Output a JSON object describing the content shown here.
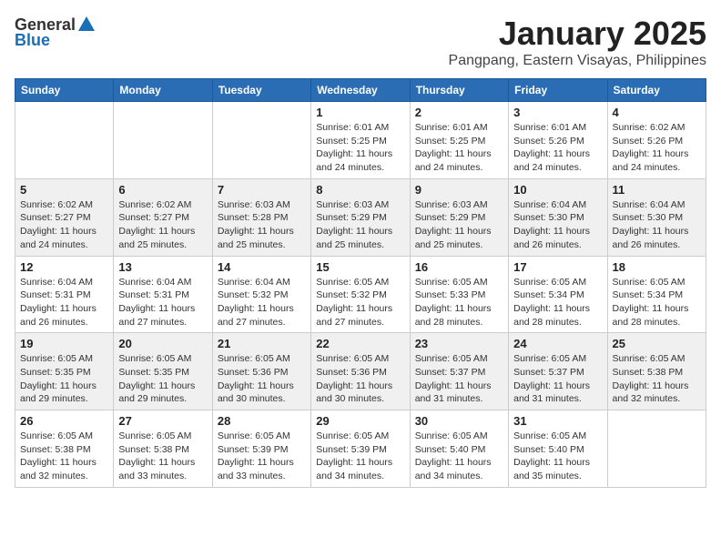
{
  "header": {
    "logo_general": "General",
    "logo_blue": "Blue",
    "month_title": "January 2025",
    "location": "Pangpang, Eastern Visayas, Philippines"
  },
  "weekdays": [
    "Sunday",
    "Monday",
    "Tuesday",
    "Wednesday",
    "Thursday",
    "Friday",
    "Saturday"
  ],
  "weeks": [
    [
      {
        "day": "",
        "sunrise": "",
        "sunset": "",
        "daylight": ""
      },
      {
        "day": "",
        "sunrise": "",
        "sunset": "",
        "daylight": ""
      },
      {
        "day": "",
        "sunrise": "",
        "sunset": "",
        "daylight": ""
      },
      {
        "day": "1",
        "sunrise": "Sunrise: 6:01 AM",
        "sunset": "Sunset: 5:25 PM",
        "daylight": "Daylight: 11 hours and 24 minutes."
      },
      {
        "day": "2",
        "sunrise": "Sunrise: 6:01 AM",
        "sunset": "Sunset: 5:25 PM",
        "daylight": "Daylight: 11 hours and 24 minutes."
      },
      {
        "day": "3",
        "sunrise": "Sunrise: 6:01 AM",
        "sunset": "Sunset: 5:26 PM",
        "daylight": "Daylight: 11 hours and 24 minutes."
      },
      {
        "day": "4",
        "sunrise": "Sunrise: 6:02 AM",
        "sunset": "Sunset: 5:26 PM",
        "daylight": "Daylight: 11 hours and 24 minutes."
      }
    ],
    [
      {
        "day": "5",
        "sunrise": "Sunrise: 6:02 AM",
        "sunset": "Sunset: 5:27 PM",
        "daylight": "Daylight: 11 hours and 24 minutes."
      },
      {
        "day": "6",
        "sunrise": "Sunrise: 6:02 AM",
        "sunset": "Sunset: 5:27 PM",
        "daylight": "Daylight: 11 hours and 25 minutes."
      },
      {
        "day": "7",
        "sunrise": "Sunrise: 6:03 AM",
        "sunset": "Sunset: 5:28 PM",
        "daylight": "Daylight: 11 hours and 25 minutes."
      },
      {
        "day": "8",
        "sunrise": "Sunrise: 6:03 AM",
        "sunset": "Sunset: 5:29 PM",
        "daylight": "Daylight: 11 hours and 25 minutes."
      },
      {
        "day": "9",
        "sunrise": "Sunrise: 6:03 AM",
        "sunset": "Sunset: 5:29 PM",
        "daylight": "Daylight: 11 hours and 25 minutes."
      },
      {
        "day": "10",
        "sunrise": "Sunrise: 6:04 AM",
        "sunset": "Sunset: 5:30 PM",
        "daylight": "Daylight: 11 hours and 26 minutes."
      },
      {
        "day": "11",
        "sunrise": "Sunrise: 6:04 AM",
        "sunset": "Sunset: 5:30 PM",
        "daylight": "Daylight: 11 hours and 26 minutes."
      }
    ],
    [
      {
        "day": "12",
        "sunrise": "Sunrise: 6:04 AM",
        "sunset": "Sunset: 5:31 PM",
        "daylight": "Daylight: 11 hours and 26 minutes."
      },
      {
        "day": "13",
        "sunrise": "Sunrise: 6:04 AM",
        "sunset": "Sunset: 5:31 PM",
        "daylight": "Daylight: 11 hours and 27 minutes."
      },
      {
        "day": "14",
        "sunrise": "Sunrise: 6:04 AM",
        "sunset": "Sunset: 5:32 PM",
        "daylight": "Daylight: 11 hours and 27 minutes."
      },
      {
        "day": "15",
        "sunrise": "Sunrise: 6:05 AM",
        "sunset": "Sunset: 5:32 PM",
        "daylight": "Daylight: 11 hours and 27 minutes."
      },
      {
        "day": "16",
        "sunrise": "Sunrise: 6:05 AM",
        "sunset": "Sunset: 5:33 PM",
        "daylight": "Daylight: 11 hours and 28 minutes."
      },
      {
        "day": "17",
        "sunrise": "Sunrise: 6:05 AM",
        "sunset": "Sunset: 5:34 PM",
        "daylight": "Daylight: 11 hours and 28 minutes."
      },
      {
        "day": "18",
        "sunrise": "Sunrise: 6:05 AM",
        "sunset": "Sunset: 5:34 PM",
        "daylight": "Daylight: 11 hours and 28 minutes."
      }
    ],
    [
      {
        "day": "19",
        "sunrise": "Sunrise: 6:05 AM",
        "sunset": "Sunset: 5:35 PM",
        "daylight": "Daylight: 11 hours and 29 minutes."
      },
      {
        "day": "20",
        "sunrise": "Sunrise: 6:05 AM",
        "sunset": "Sunset: 5:35 PM",
        "daylight": "Daylight: 11 hours and 29 minutes."
      },
      {
        "day": "21",
        "sunrise": "Sunrise: 6:05 AM",
        "sunset": "Sunset: 5:36 PM",
        "daylight": "Daylight: 11 hours and 30 minutes."
      },
      {
        "day": "22",
        "sunrise": "Sunrise: 6:05 AM",
        "sunset": "Sunset: 5:36 PM",
        "daylight": "Daylight: 11 hours and 30 minutes."
      },
      {
        "day": "23",
        "sunrise": "Sunrise: 6:05 AM",
        "sunset": "Sunset: 5:37 PM",
        "daylight": "Daylight: 11 hours and 31 minutes."
      },
      {
        "day": "24",
        "sunrise": "Sunrise: 6:05 AM",
        "sunset": "Sunset: 5:37 PM",
        "daylight": "Daylight: 11 hours and 31 minutes."
      },
      {
        "day": "25",
        "sunrise": "Sunrise: 6:05 AM",
        "sunset": "Sunset: 5:38 PM",
        "daylight": "Daylight: 11 hours and 32 minutes."
      }
    ],
    [
      {
        "day": "26",
        "sunrise": "Sunrise: 6:05 AM",
        "sunset": "Sunset: 5:38 PM",
        "daylight": "Daylight: 11 hours and 32 minutes."
      },
      {
        "day": "27",
        "sunrise": "Sunrise: 6:05 AM",
        "sunset": "Sunset: 5:38 PM",
        "daylight": "Daylight: 11 hours and 33 minutes."
      },
      {
        "day": "28",
        "sunrise": "Sunrise: 6:05 AM",
        "sunset": "Sunset: 5:39 PM",
        "daylight": "Daylight: 11 hours and 33 minutes."
      },
      {
        "day": "29",
        "sunrise": "Sunrise: 6:05 AM",
        "sunset": "Sunset: 5:39 PM",
        "daylight": "Daylight: 11 hours and 34 minutes."
      },
      {
        "day": "30",
        "sunrise": "Sunrise: 6:05 AM",
        "sunset": "Sunset: 5:40 PM",
        "daylight": "Daylight: 11 hours and 34 minutes."
      },
      {
        "day": "31",
        "sunrise": "Sunrise: 6:05 AM",
        "sunset": "Sunset: 5:40 PM",
        "daylight": "Daylight: 11 hours and 35 minutes."
      },
      {
        "day": "",
        "sunrise": "",
        "sunset": "",
        "daylight": ""
      }
    ]
  ]
}
